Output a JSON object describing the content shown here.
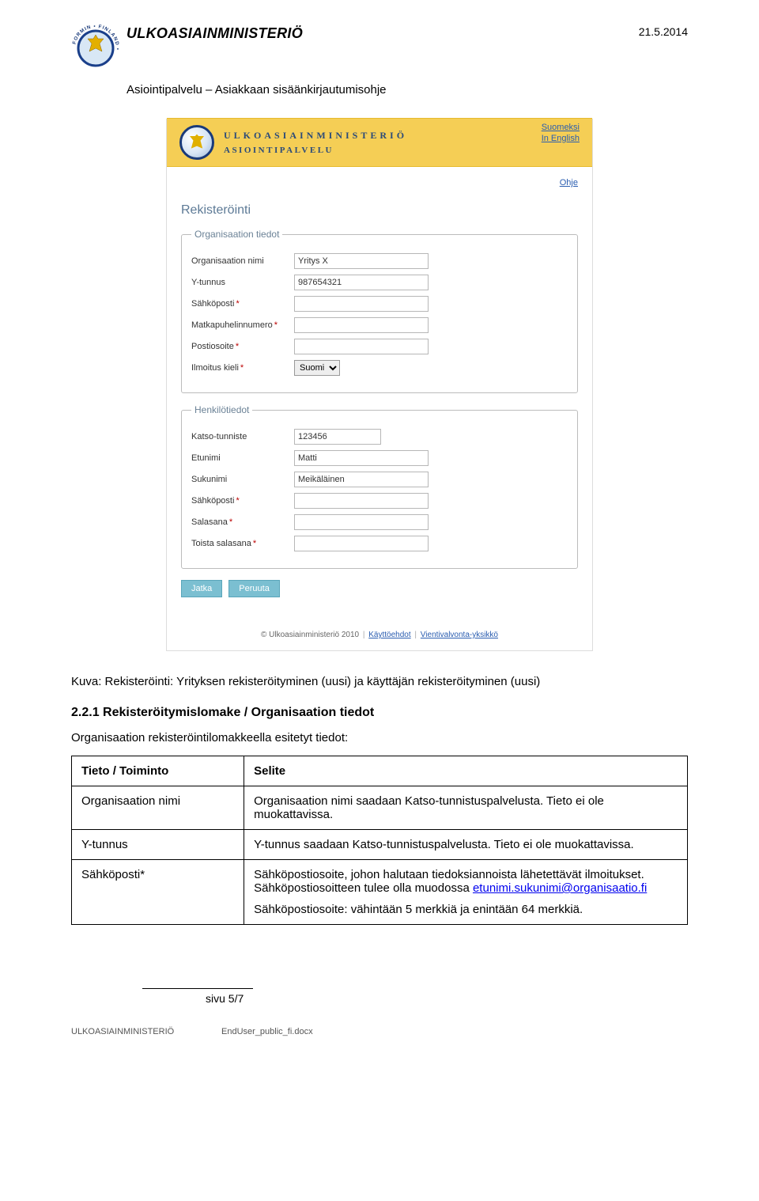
{
  "header": {
    "ministry": "ULKOASIAINMINISTERIÖ",
    "date": "21.5.2014",
    "subtitle": "Asiointipalvelu – Asiakkaan sisäänkirjautumisohje"
  },
  "screenshot": {
    "lang_fi": "Suomeksi",
    "lang_en": "In English",
    "ministry_line": "ULKOASIAINMINISTERIÖ",
    "service_line": "ASIOINTIPALVELU",
    "help": "Ohje",
    "title": "Rekisteröinti",
    "org_legend": "Organisaation tiedot",
    "org": {
      "name_label": "Organisaation nimi",
      "name_value": "Yritys X",
      "ytunnus_label": "Y-tunnus",
      "ytunnus_value": "987654321",
      "email_label": "Sähköposti",
      "phone_label": "Matkapuhelinnumero",
      "address_label": "Postiosoite",
      "lang_label": "Ilmoitus kieli",
      "lang_value": "Suomi"
    },
    "person_legend": "Henkilötiedot",
    "person": {
      "katso_label": "Katso-tunniste",
      "katso_value": "123456",
      "first_label": "Etunimi",
      "first_value": "Matti",
      "last_label": "Sukunimi",
      "last_value": "Meikäläinen",
      "email_label": "Sähköposti",
      "pass_label": "Salasana",
      "pass2_label": "Toista salasana"
    },
    "btn_continue": "Jatka",
    "btn_cancel": "Peruuta",
    "footer_copy": "© Ulkoasiainministeriö 2010",
    "footer_terms": "Käyttöehdot",
    "footer_unit": "Vientivalvonta-yksikkö"
  },
  "caption": "Kuva: Rekisteröinti: Yrityksen rekisteröityminen (uusi) ja käyttäjän rekisteröityminen (uusi)",
  "section_heading": "2.2.1 Rekisteröitymislomake / Organisaation tiedot",
  "intro_para": "Organisaation rekisteröintilomakkeella esitetyt tiedot:",
  "table": {
    "h1": "Tieto / Toiminto",
    "h2": "Selite",
    "rows": [
      {
        "c1": "Organisaation nimi",
        "c2": "Organisaation nimi saadaan Katso-tunnistuspalvelusta. Tieto ei ole muokattavissa."
      },
      {
        "c1": "Y-tunnus",
        "c2": "Y-tunnus saadaan Katso-tunnistuspalvelusta. Tieto ei ole muokattavissa."
      },
      {
        "c1": "Sähköposti*",
        "c2a": "Sähköpostiosoite, johon halutaan tiedoksiannoista lähetettävät ilmoitukset. Sähköpostiosoitteen tulee olla muodossa ",
        "c2link": "etunimi.sukunimi@organisaatio.fi",
        "c2b": "Sähköpostiosoite: vähintään 5 merkkiä ja enintään 64 merkkiä."
      }
    ]
  },
  "footer": {
    "page": "sivu 5/7",
    "ministry": "ULKOASIAINMINISTERIÖ",
    "file": "EndUser_public_fi.docx"
  }
}
